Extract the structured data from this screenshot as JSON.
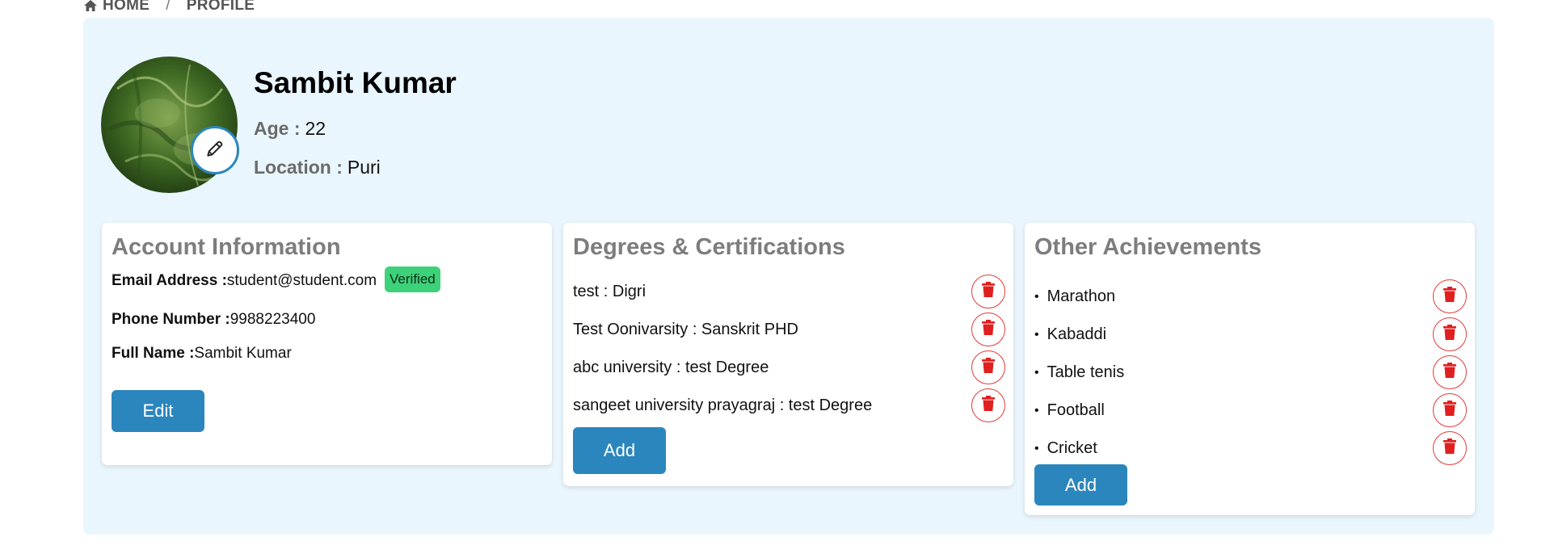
{
  "breadcrumb": {
    "home": "HOME",
    "separator": "/",
    "current": "PROFILE"
  },
  "profile": {
    "name": "Sambit Kumar",
    "age_label": "Age :",
    "age": "22",
    "location_label": "Location :",
    "location": "Puri"
  },
  "account": {
    "title": "Account Information",
    "email_label": "Email Address :",
    "email": "student@student.com",
    "verified": "Verified",
    "phone_label": "Phone Number :",
    "phone": "9988223400",
    "fullname_label": "Full Name :",
    "fullname": "Sambit Kumar",
    "edit_label": "Edit"
  },
  "degrees": {
    "title": "Degrees & Certifications",
    "items": [
      "test : Digri",
      "Test Oonivarsity : Sanskrit PHD",
      "abc university : test Degree",
      "sangeet university prayagraj : test Degree"
    ],
    "add_label": "Add"
  },
  "achievements": {
    "title": "Other Achievements",
    "items": [
      "Marathon",
      "Kabaddi",
      "Table tenis",
      "Football",
      "Cricket"
    ],
    "add_label": "Add"
  },
  "colors": {
    "accent": "#2b86bd",
    "panel_bg": "#eaf6fd",
    "verified": "#3dd27a",
    "danger": "#e23a3a"
  },
  "icons": {
    "breadcrumb_home": "home-icon",
    "avatar_edit": "pencil-icon",
    "delete": "trash-icon"
  }
}
